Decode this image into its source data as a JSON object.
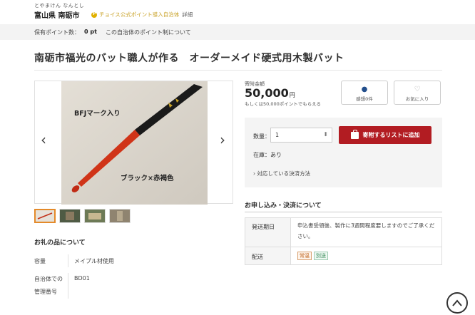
{
  "header": {
    "furigana": "とやまけん なんとし",
    "municipality": "富山県 南砺市",
    "point_badge": "チョイス公式ポイント導入自治体",
    "detail_link": "詳細"
  },
  "points_bar": {
    "label": "保有ポイント数：",
    "value": "0 pt",
    "link": "この自治体のポイント制について"
  },
  "product": {
    "title": "南砺市福光のバット職人が作る　オーダーメイド硬式用木製バット",
    "image_text": {
      "mark": "BFJマーク入り",
      "color": "ブラック×赤褐色"
    },
    "thumbnail_count": 4
  },
  "price": {
    "label": "寄附金額",
    "amount": "50,000",
    "unit": "円",
    "note": "もしくは50,000ポイントでもらえる"
  },
  "actions": {
    "review": "感想0件",
    "favorite": "お気に入り"
  },
  "cart": {
    "qty_label": "数量：",
    "qty_value": "1",
    "add_button": "寄附するリストに追加",
    "stock": "在庫：あり",
    "payment_link": "› 対応している決済方法"
  },
  "gift_info": {
    "heading": "お礼の品について",
    "rows": [
      {
        "key": "容量",
        "value": "メイプル材使用"
      },
      {
        "key1": "自治体での",
        "key2": "管理番号",
        "value": "BD01"
      }
    ]
  },
  "application": {
    "heading": "お申し込み・決済について",
    "ship_label": "発送期日",
    "ship_value": "申込書受領後、製作に3週間程度要しますのでご了承ください。",
    "delivery_label": "配送",
    "tags": [
      "常温",
      "別送"
    ]
  },
  "colors": {
    "accent_red": "#b21c22",
    "bat_red": "#d03418",
    "point_gold": "#e0b000"
  }
}
